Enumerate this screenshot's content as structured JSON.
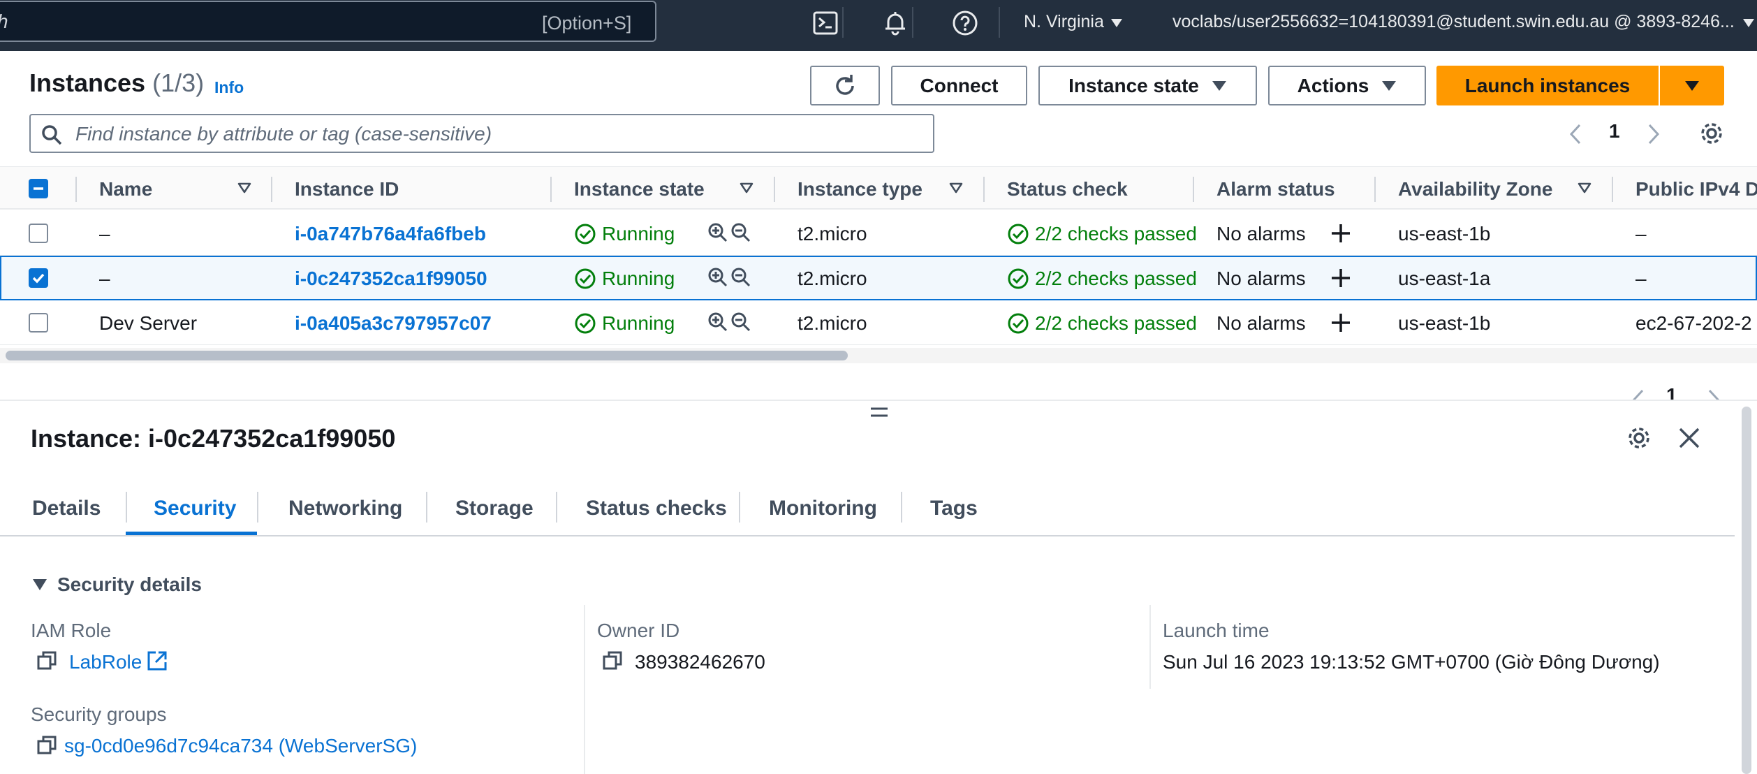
{
  "topbar": {
    "search_partial": "h",
    "search_shortcut": "[Option+S]",
    "region": "N. Virginia",
    "account": "voclabs/user2556632=104180391@student.swin.edu.au @ 3893-8246..."
  },
  "instances_header": {
    "title": "Instances",
    "count": "(1/3)",
    "info": "Info",
    "connect_label": "Connect",
    "instance_state_label": "Instance state",
    "actions_label": "Actions",
    "launch_label": "Launch instances",
    "filter_placeholder": "Find instance by attribute or tag (case-sensitive)",
    "page": "1"
  },
  "table": {
    "columns": [
      "Name",
      "Instance ID",
      "Instance state",
      "Instance type",
      "Status check",
      "Alarm status",
      "Availability Zone",
      "Public IPv4 D"
    ],
    "rows": [
      {
        "name": "–",
        "id": "i-0a747b76a4fa6fbeb",
        "state": "Running",
        "type": "t2.micro",
        "status": "2/2 checks passed",
        "alarm": "No alarms",
        "az": "us-east-1b",
        "ipv4": "–",
        "selected": false
      },
      {
        "name": "–",
        "id": "i-0c247352ca1f99050",
        "state": "Running",
        "type": "t2.micro",
        "status": "2/2 checks passed",
        "alarm": "No alarms",
        "az": "us-east-1a",
        "ipv4": "–",
        "selected": true
      },
      {
        "name": "Dev Server",
        "id": "i-0a405a3c797957c07",
        "state": "Running",
        "type": "t2.micro",
        "status": "2/2 checks passed",
        "alarm": "No alarms",
        "az": "us-east-1b",
        "ipv4": "ec2-67-202-2",
        "selected": false
      }
    ]
  },
  "detail": {
    "page": "1",
    "title": "Instance: i-0c247352ca1f99050",
    "tabs": [
      "Details",
      "Security",
      "Networking",
      "Storage",
      "Status checks",
      "Monitoring",
      "Tags"
    ],
    "active_tab": "Security",
    "section_title": "Security details",
    "iam_role_label": "IAM Role",
    "iam_role_value": "LabRole",
    "owner_id_label": "Owner ID",
    "owner_id_value": "389382462670",
    "launch_time_label": "Launch time",
    "launch_time_value": "Sun Jul 16 2023 19:13:52 GMT+0700 (Giờ Đông Dương)",
    "security_groups_label": "Security groups",
    "security_groups_value": "sg-0cd0e96d7c94ca734 (WebServerSG)"
  },
  "colors": {
    "topbar": "#232f3e",
    "link": "#0972d3",
    "success": "#037f0c",
    "primary_button": "#ff9900"
  }
}
